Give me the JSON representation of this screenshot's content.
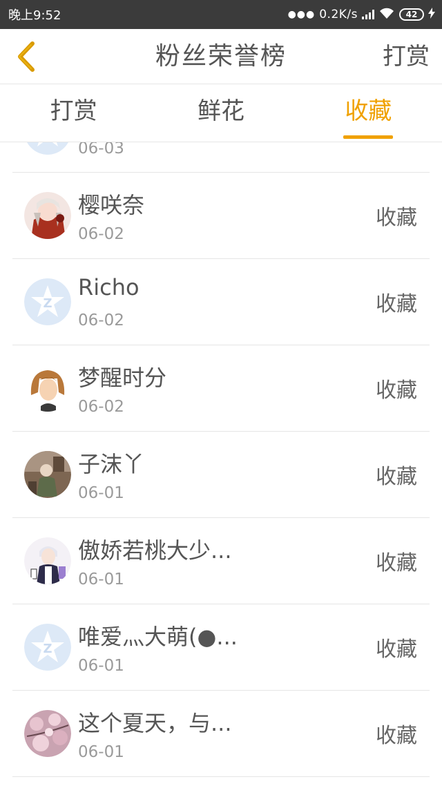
{
  "status_bar": {
    "time": "晚上9:52",
    "network_speed": "0.2K/s",
    "battery": "42",
    "icons": [
      "dots-icon",
      "signal-icon",
      "wifi-icon",
      "battery-icon",
      "charging-icon"
    ]
  },
  "header": {
    "title": "粉丝荣誉榜",
    "right_link": "打赏",
    "back_icon": "chevron-left-icon"
  },
  "tabs": [
    {
      "label": "打赏",
      "active": false
    },
    {
      "label": "鲜花",
      "active": false
    },
    {
      "label": "收藏",
      "active": true
    }
  ],
  "colors": {
    "accent": "#f0a100",
    "status_bar": "#3b3b3b",
    "text": "#555555",
    "subtext": "#9a9a9a",
    "divider": "#e5e5e5",
    "default_avatar": "#dde9f7"
  },
  "list": [
    {
      "name": "",
      "date": "06-03",
      "action": "",
      "avatar": "default-qq-avatar"
    },
    {
      "name": "樱咲奈",
      "date": "06-02",
      "action": "收藏",
      "avatar": "anime-girl-red-avatar"
    },
    {
      "name": "Richo",
      "date": "06-02",
      "action": "收藏",
      "avatar": "default-qq-avatar"
    },
    {
      "name": "梦醒时分",
      "date": "06-02",
      "action": "收藏",
      "avatar": "brown-hair-avatar"
    },
    {
      "name": "子沫丫",
      "date": "06-01",
      "action": "收藏",
      "avatar": "photo-avatar"
    },
    {
      "name": "傲娇若桃大少...",
      "date": "06-01",
      "action": "收藏",
      "avatar": "anime-boy-avatar"
    },
    {
      "name": "唯爱灬大萌(●...",
      "date": "06-01",
      "action": "收藏",
      "avatar": "default-qq-avatar"
    },
    {
      "name": "这个夏天，与...",
      "date": "06-01",
      "action": "收藏",
      "avatar": "blossom-avatar"
    }
  ]
}
